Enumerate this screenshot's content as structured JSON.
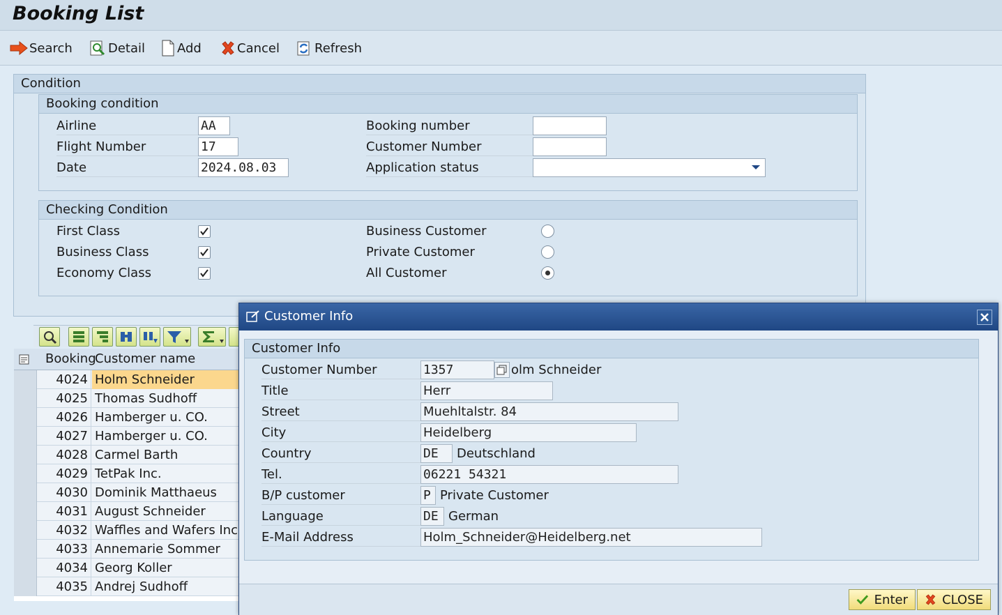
{
  "window": {
    "title": "Booking List"
  },
  "toolbar": {
    "search": "Search",
    "detail": "Detail",
    "add": "Add",
    "cancel": "Cancel",
    "refresh": "Refresh"
  },
  "condition": {
    "title": "Condition",
    "booking": {
      "title": "Booking condition",
      "airline_label": "Airline",
      "airline_value": "AA",
      "flight_label": "Flight Number",
      "flight_value": "17",
      "date_label": "Date",
      "date_value": "2024.08.03",
      "booking_number_label": "Booking number",
      "booking_number_value": "",
      "customer_number_label": "Customer Number",
      "customer_number_value": "",
      "status_label": "Application status",
      "status_value": ""
    },
    "checking": {
      "title": "Checking Condition",
      "first_class": "First Class",
      "business_class": "Business Class",
      "economy_class": "Economy Class",
      "business_customer": "Business Customer",
      "private_customer": "Private Customer",
      "all_customer": "All Customer",
      "first_checked": true,
      "business_checked": true,
      "economy_checked": true,
      "selected_customer": "All Customer"
    }
  },
  "grid": {
    "col_booking": "Booking",
    "col_customer": "Customer name",
    "rows": [
      {
        "booking": "4024",
        "name": "Holm Schneider"
      },
      {
        "booking": "4025",
        "name": "Thomas Sudhoff"
      },
      {
        "booking": "4026",
        "name": "Hamberger u. CO."
      },
      {
        "booking": "4027",
        "name": "Hamberger u. CO."
      },
      {
        "booking": "4028",
        "name": "Carmel Barth"
      },
      {
        "booking": "4029",
        "name": "TetPak Inc."
      },
      {
        "booking": "4030",
        "name": "Dominik Matthaeus"
      },
      {
        "booking": "4031",
        "name": "August Schneider"
      },
      {
        "booking": "4032",
        "name": "Waffles and Wafers Inc."
      },
      {
        "booking": "4033",
        "name": "Annemarie Sommer"
      },
      {
        "booking": "4034",
        "name": "Georg Koller"
      },
      {
        "booking": "4035",
        "name": "Andrej Sudhoff"
      }
    ]
  },
  "dialog": {
    "title": "Customer Info",
    "group_title": "Customer Info",
    "customer_number_label": "Customer Number",
    "customer_number": "1357",
    "customer_name_suffix": "olm Schneider",
    "title_label": "Title",
    "title_value": "Herr",
    "street_label": "Street",
    "street_value": "Muehltalstr. 84",
    "city_label": "City",
    "city_value": "Heidelberg",
    "country_label": "Country",
    "country_code": "DE",
    "country_name": "Deutschland",
    "tel_label": "Tel.",
    "tel_value": "06221 54321",
    "bp_label": "B/P customer",
    "bp_code": "P",
    "bp_text": "Private Customer",
    "language_label": "Language",
    "language_code": "DE",
    "language_text": "German",
    "email_label": "E-Mail Address",
    "email_value": "Holm_Schneider@Heidelberg.net",
    "enter_button": "Enter",
    "close_button": "CLOSE"
  },
  "colors": {
    "accent": "#1f4784",
    "highlight": "#fbd78d",
    "background": "#dfebf5"
  }
}
